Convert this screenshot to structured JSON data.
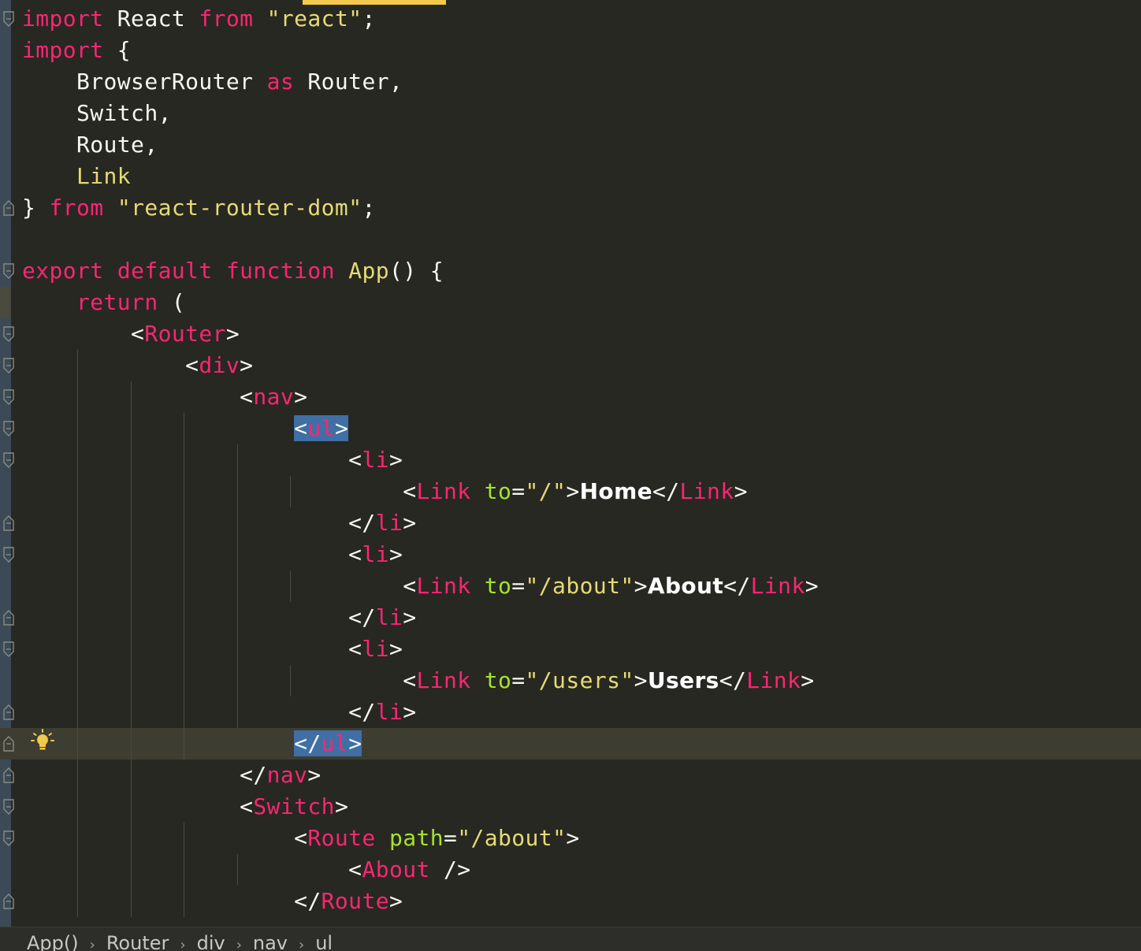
{
  "colors": {
    "background": "#272822",
    "keyword": "#f92672",
    "string": "#e6db74",
    "attribute": "#a6e22e",
    "plain": "#f8f8f2",
    "selection": "#3f6fa5",
    "current_line": "#3e3d32",
    "accent": "#f2c94c"
  },
  "code_lines": [
    {
      "fold": "open",
      "tokens": [
        {
          "c": "k",
          "x": "import"
        },
        {
          "c": "p",
          "x": " React "
        },
        {
          "c": "k",
          "x": "from"
        },
        {
          "c": "p",
          "x": " "
        },
        {
          "c": "s",
          "x": "\"react\""
        },
        {
          "c": "p",
          "x": ";"
        }
      ]
    },
    {
      "fold": "",
      "tokens": [
        {
          "c": "k",
          "x": "import"
        },
        {
          "c": "p",
          "x": " {"
        }
      ]
    },
    {
      "fold": "",
      "tokens": [
        {
          "c": "p",
          "x": "    BrowserRouter "
        },
        {
          "c": "k",
          "x": "as"
        },
        {
          "c": "p",
          "x": " Router,"
        }
      ]
    },
    {
      "fold": "",
      "tokens": [
        {
          "c": "p",
          "x": "    Switch,"
        }
      ]
    },
    {
      "fold": "",
      "tokens": [
        {
          "c": "p",
          "x": "    Route,"
        }
      ]
    },
    {
      "fold": "",
      "tokens": [
        {
          "c": "p",
          "x": "    "
        },
        {
          "c": "f",
          "x": "Link"
        }
      ]
    },
    {
      "fold": "close",
      "tokens": [
        {
          "c": "p",
          "x": "} "
        },
        {
          "c": "k",
          "x": "from"
        },
        {
          "c": "p",
          "x": " "
        },
        {
          "c": "s",
          "x": "\"react-router-dom\""
        },
        {
          "c": "p",
          "x": ";"
        }
      ]
    },
    {
      "fold": "",
      "tokens": []
    },
    {
      "fold": "open",
      "tokens": [
        {
          "c": "k",
          "x": "export"
        },
        {
          "c": "p",
          "x": " "
        },
        {
          "c": "k",
          "x": "default"
        },
        {
          "c": "p",
          "x": " "
        },
        {
          "c": "k",
          "x": "function"
        },
        {
          "c": "p",
          "x": " "
        },
        {
          "c": "f",
          "x": "App"
        },
        {
          "c": "p",
          "x": "() {"
        }
      ]
    },
    {
      "fold": "",
      "tokens": [
        {
          "c": "p",
          "x": "    "
        },
        {
          "c": "k",
          "x": "return"
        },
        {
          "c": "p",
          "x": " ("
        }
      ]
    },
    {
      "fold": "open",
      "tokens": [
        {
          "c": "p",
          "x": "        <"
        },
        {
          "c": "t",
          "x": "Router"
        },
        {
          "c": "p",
          "x": ">"
        }
      ]
    },
    {
      "fold": "open",
      "tokens": [
        {
          "c": "p",
          "x": "            <"
        },
        {
          "c": "t",
          "x": "div"
        },
        {
          "c": "p",
          "x": ">"
        }
      ]
    },
    {
      "fold": "open",
      "tokens": [
        {
          "c": "p",
          "x": "                <"
        },
        {
          "c": "t",
          "x": "nav"
        },
        {
          "c": "p",
          "x": ">"
        }
      ]
    },
    {
      "fold": "open",
      "tokens": [
        {
          "c": "p",
          "x": "                    "
        },
        {
          "c": "p",
          "x": "<",
          "sel": true
        },
        {
          "c": "t",
          "x": "ul",
          "sel": true
        },
        {
          "c": "p",
          "x": ">",
          "sel": true
        }
      ]
    },
    {
      "fold": "open",
      "tokens": [
        {
          "c": "p",
          "x": "                        <"
        },
        {
          "c": "t",
          "x": "li"
        },
        {
          "c": "p",
          "x": ">"
        }
      ]
    },
    {
      "fold": "",
      "tokens": [
        {
          "c": "p",
          "x": "                            <"
        },
        {
          "c": "t",
          "x": "Link"
        },
        {
          "c": "p",
          "x": " "
        },
        {
          "c": "a",
          "x": "to"
        },
        {
          "c": "p",
          "x": "="
        },
        {
          "c": "s",
          "x": "\"/\""
        },
        {
          "c": "p",
          "x": ">"
        },
        {
          "c": "b",
          "x": "Home"
        },
        {
          "c": "p",
          "x": "</"
        },
        {
          "c": "t",
          "x": "Link"
        },
        {
          "c": "p",
          "x": ">"
        }
      ]
    },
    {
      "fold": "close",
      "tokens": [
        {
          "c": "p",
          "x": "                        </"
        },
        {
          "c": "t",
          "x": "li"
        },
        {
          "c": "p",
          "x": ">"
        }
      ]
    },
    {
      "fold": "open",
      "tokens": [
        {
          "c": "p",
          "x": "                        <"
        },
        {
          "c": "t",
          "x": "li"
        },
        {
          "c": "p",
          "x": ">"
        }
      ]
    },
    {
      "fold": "",
      "tokens": [
        {
          "c": "p",
          "x": "                            <"
        },
        {
          "c": "t",
          "x": "Link"
        },
        {
          "c": "p",
          "x": " "
        },
        {
          "c": "a",
          "x": "to"
        },
        {
          "c": "p",
          "x": "="
        },
        {
          "c": "s",
          "x": "\"/about\""
        },
        {
          "c": "p",
          "x": ">"
        },
        {
          "c": "b",
          "x": "About"
        },
        {
          "c": "p",
          "x": "</"
        },
        {
          "c": "t",
          "x": "Link"
        },
        {
          "c": "p",
          "x": ">"
        }
      ]
    },
    {
      "fold": "close",
      "tokens": [
        {
          "c": "p",
          "x": "                        </"
        },
        {
          "c": "t",
          "x": "li"
        },
        {
          "c": "p",
          "x": ">"
        }
      ]
    },
    {
      "fold": "open",
      "tokens": [
        {
          "c": "p",
          "x": "                        <"
        },
        {
          "c": "t",
          "x": "li"
        },
        {
          "c": "p",
          "x": ">"
        }
      ]
    },
    {
      "fold": "",
      "tokens": [
        {
          "c": "p",
          "x": "                            <"
        },
        {
          "c": "t",
          "x": "Link"
        },
        {
          "c": "p",
          "x": " "
        },
        {
          "c": "a",
          "x": "to"
        },
        {
          "c": "p",
          "x": "="
        },
        {
          "c": "s",
          "x": "\"/users\""
        },
        {
          "c": "p",
          "x": ">"
        },
        {
          "c": "b",
          "x": "Users"
        },
        {
          "c": "p",
          "x": "</"
        },
        {
          "c": "t",
          "x": "Link"
        },
        {
          "c": "p",
          "x": ">"
        }
      ]
    },
    {
      "fold": "close",
      "tokens": [
        {
          "c": "p",
          "x": "                        </"
        },
        {
          "c": "t",
          "x": "li"
        },
        {
          "c": "p",
          "x": ">"
        }
      ]
    },
    {
      "fold": "close",
      "current": true,
      "tokens": [
        {
          "c": "p",
          "x": "                    "
        },
        {
          "c": "p",
          "x": "</",
          "sel": true
        },
        {
          "c": "t",
          "x": "ul",
          "sel": true
        },
        {
          "c": "p",
          "x": ">",
          "sel": true
        }
      ]
    },
    {
      "fold": "close",
      "tokens": [
        {
          "c": "p",
          "x": "                </"
        },
        {
          "c": "t",
          "x": "nav"
        },
        {
          "c": "p",
          "x": ">"
        }
      ]
    },
    {
      "fold": "open",
      "tokens": [
        {
          "c": "p",
          "x": "                <"
        },
        {
          "c": "t",
          "x": "Switch"
        },
        {
          "c": "p",
          "x": ">"
        }
      ]
    },
    {
      "fold": "open",
      "tokens": [
        {
          "c": "p",
          "x": "                    <"
        },
        {
          "c": "t",
          "x": "Route"
        },
        {
          "c": "p",
          "x": " "
        },
        {
          "c": "a",
          "x": "path"
        },
        {
          "c": "p",
          "x": "="
        },
        {
          "c": "s",
          "x": "\"/about\""
        },
        {
          "c": "p",
          "x": ">"
        }
      ]
    },
    {
      "fold": "",
      "tokens": [
        {
          "c": "p",
          "x": "                        <"
        },
        {
          "c": "t",
          "x": "About"
        },
        {
          "c": "p",
          "x": " />"
        }
      ]
    },
    {
      "fold": "close",
      "tokens": [
        {
          "c": "p",
          "x": "                    </"
        },
        {
          "c": "t",
          "x": "Route"
        },
        {
          "c": "p",
          "x": ">"
        }
      ]
    }
  ],
  "breadcrumb": [
    "App()",
    "Router",
    "div",
    "nav",
    "ul"
  ],
  "icons": {
    "bulb": "lightbulb-icon",
    "fold_open": "fold-open-icon",
    "fold_close": "fold-close-icon",
    "crumb_sep": "chevron-right-icon"
  },
  "breadcrumb_separator": "›"
}
